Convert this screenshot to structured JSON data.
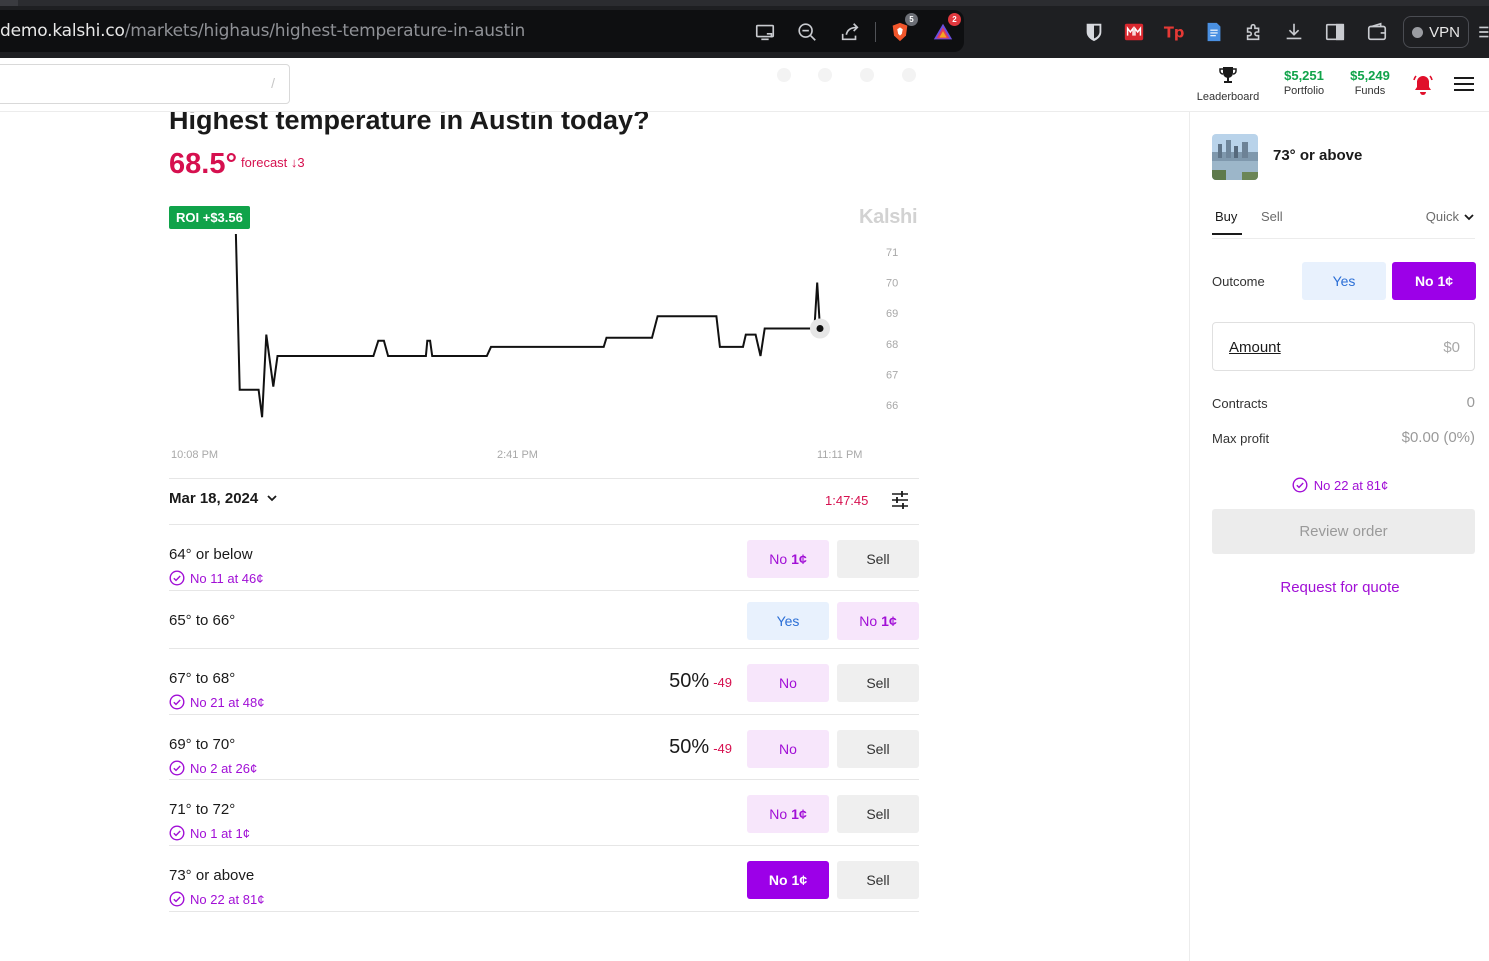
{
  "browser": {
    "url_host": "demo.kalshi.co",
    "url_path": "/markets/highaus/highest-temperature-in-austin",
    "brave_badge": "5",
    "alerts_badge": "2",
    "vpn_label": "VPN"
  },
  "header": {
    "search_hint": "/",
    "leaderboard_label": "Leaderboard",
    "portfolio_value": "$5,251",
    "portfolio_label": "Portfolio",
    "funds_value": "$5,249",
    "funds_label": "Funds",
    "colors": {
      "gain": "#10a34a",
      "alert": "#e0102b"
    }
  },
  "market": {
    "title": "Highest temperature in Austin today?",
    "forecast_value": "68.5°",
    "forecast_label": "forecast ↓3",
    "roi_badge": "ROI +$3.56",
    "watermark": "Kalshi",
    "date": "Mar 18, 2024",
    "timer": "1:47:45",
    "colors": {
      "accent": "#9c00e8",
      "negative": "#d6104f",
      "positive": "#10a34a"
    }
  },
  "chart_data": {
    "type": "line",
    "title": "",
    "xlabel": "",
    "ylabel": "",
    "x_ticks": [
      "10:08 PM",
      "2:41 PM",
      "11:11 PM"
    ],
    "y_ticks": [
      66,
      67,
      68,
      69,
      70,
      71
    ],
    "ylim": [
      65.6,
      71.3
    ],
    "grid": false,
    "series": [
      {
        "values": [
          [
            0,
            72.1
          ],
          [
            0.095,
            72.1
          ],
          [
            0.101,
            66.5
          ],
          [
            0.128,
            66.5
          ],
          [
            0.133,
            65.6
          ],
          [
            0.139,
            68.3
          ],
          [
            0.149,
            66.6
          ],
          [
            0.155,
            67.6
          ],
          [
            0.292,
            67.6
          ],
          [
            0.299,
            68.1
          ],
          [
            0.307,
            68.1
          ],
          [
            0.313,
            67.6
          ],
          [
            0.367,
            67.6
          ],
          [
            0.369,
            68.1
          ],
          [
            0.373,
            68.1
          ],
          [
            0.376,
            67.6
          ],
          [
            0.454,
            67.6
          ],
          [
            0.46,
            67.9
          ],
          [
            0.621,
            67.9
          ],
          [
            0.625,
            68.2
          ],
          [
            0.69,
            68.2
          ],
          [
            0.698,
            68.9
          ],
          [
            0.782,
            68.9
          ],
          [
            0.787,
            67.9
          ],
          [
            0.82,
            67.9
          ],
          [
            0.824,
            68.3
          ],
          [
            0.838,
            68.3
          ],
          [
            0.845,
            67.6
          ],
          [
            0.851,
            68.5
          ],
          [
            0.922,
            68.5
          ],
          [
            0.926,
            70.0
          ],
          [
            0.93,
            68.5
          ]
        ]
      }
    ]
  },
  "outcomes": [
    {
      "name": "64° or below",
      "owned": "No 11 at 46¢",
      "pct": "",
      "pct_change": "",
      "btn1": "No",
      "btn1_price": "1¢",
      "btn2": "Sell"
    },
    {
      "name": "65° to 66°",
      "owned": "",
      "pct": "",
      "pct_change": "",
      "btn1": "Yes",
      "btn1_price": "",
      "btn2": "No",
      "btn2_price": "1¢"
    },
    {
      "name": "67° to 68°",
      "owned": "No 21 at 48¢",
      "pct": "50%",
      "pct_change": "-49",
      "btn1": "No",
      "btn1_price": "",
      "btn2": "Sell"
    },
    {
      "name": "69° to 70°",
      "owned": "No 2 at 26¢",
      "pct": "50%",
      "pct_change": "-49",
      "btn1": "No",
      "btn1_price": "",
      "btn2": "Sell"
    },
    {
      "name": "71° to 72°",
      "owned": "No 1 at 1¢",
      "pct": "",
      "pct_change": "",
      "btn1": "No",
      "btn1_price": "1¢",
      "btn2": "Sell"
    },
    {
      "name": "73° or above",
      "owned": "No 22 at 81¢",
      "pct": "",
      "pct_change": "",
      "btn1": "No",
      "btn1_price": "1¢",
      "btn2": "Sell"
    }
  ],
  "order_panel": {
    "market_name": "73° or above",
    "tab_buy": "Buy",
    "tab_sell": "Sell",
    "mode": "Quick",
    "outcome_label": "Outcome",
    "yes_label": "Yes",
    "no_label": "No 1¢",
    "amount_label": "Amount",
    "amount_value": "$0",
    "contracts_label": "Contracts",
    "contracts_value": "0",
    "max_profit_label": "Max profit",
    "max_profit_value": "$0.00 (0%)",
    "owned": "No 22 at 81¢",
    "review_label": "Review order",
    "rfq_label": "Request for quote"
  }
}
